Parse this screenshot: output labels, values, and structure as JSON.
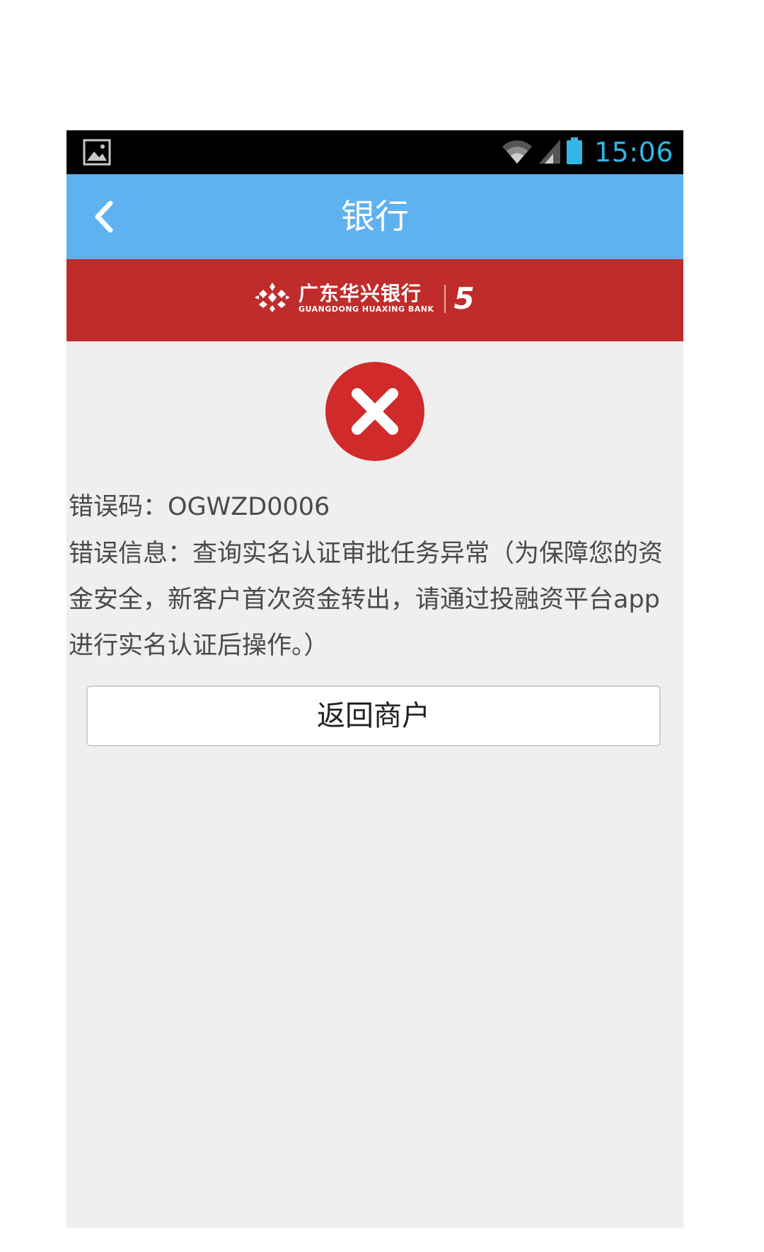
{
  "status_bar": {
    "time": "15:06",
    "icons": [
      "image-notification-icon",
      "wifi-icon",
      "signal-icon",
      "battery-icon"
    ],
    "time_color": "#33b5e5"
  },
  "header": {
    "title": "银行",
    "back_icon": "chevron-left-icon",
    "background": "#5eb2f0"
  },
  "banner": {
    "bank_name_cn": "广东华兴银行",
    "bank_name_en": "GUANGDONG HUAXING BANK",
    "badge": "5",
    "background": "#c02c2b"
  },
  "error": {
    "icon": "error-x-icon",
    "icon_color": "#d12a2a",
    "code_label": "错误码：",
    "code_value": "OGWZD0006",
    "message_label": "错误信息：",
    "message_value": "查询实名认证审批任务异常（为保障您的资金安全，新客户首次资金转出，请通过投融资平台app进行实名认证后操作。）"
  },
  "actions": {
    "return_label": "返回商户"
  }
}
